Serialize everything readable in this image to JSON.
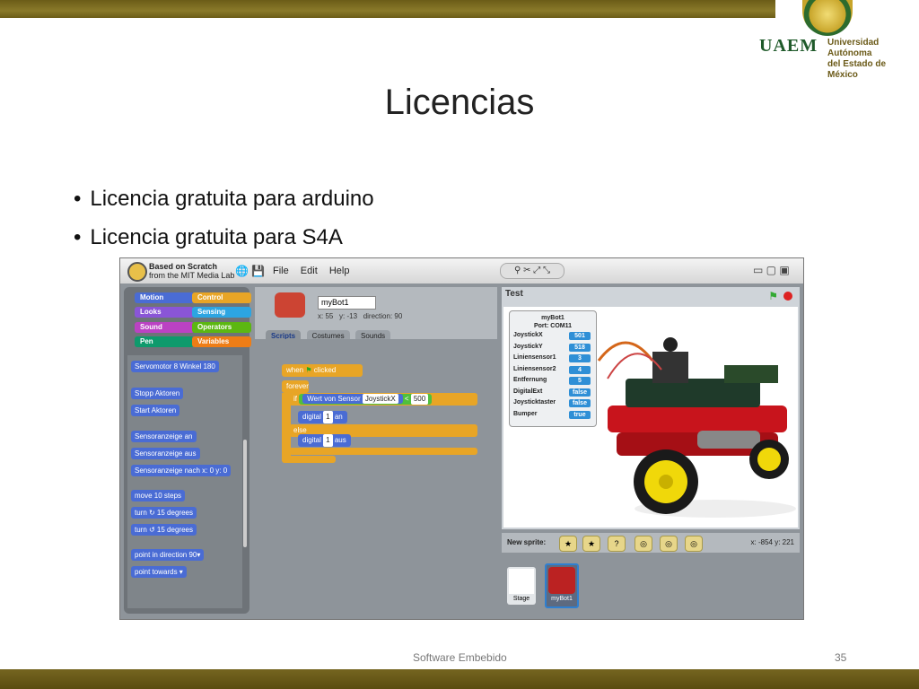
{
  "slide": {
    "title": "Licencias",
    "bullets": [
      "Licencia gratuita para arduino",
      "Licencia gratuita para S4A"
    ],
    "footer": "Software Embebido",
    "page_number": "35"
  },
  "logo": {
    "acronym": "UAEM",
    "university_line1": "Universidad Autónoma",
    "university_line2": "del Estado de México"
  },
  "scratch": {
    "brand_line1": "Based on Scratch",
    "brand_line2": "from the MIT Media Lab",
    "menu": [
      "File",
      "Edit",
      "Help"
    ],
    "categories": [
      {
        "label": "Motion",
        "color": "#4a6cd4"
      },
      {
        "label": "Control",
        "color": "#e8a526"
      },
      {
        "label": "Looks",
        "color": "#8a55d7"
      },
      {
        "label": "Sensing",
        "color": "#2ca5e2"
      },
      {
        "label": "Sound",
        "color": "#bb42c3"
      },
      {
        "label": "Operators",
        "color": "#5cb712"
      },
      {
        "label": "Pen",
        "color": "#0e9a6c"
      },
      {
        "label": "Variables",
        "color": "#ee7d16"
      }
    ],
    "palette_blocks": [
      "Servomotor 8 Winkel 180",
      "Stopp Aktoren",
      "Start Aktoren",
      "Sensoranzeige an",
      "Sensoranzeige aus",
      "Sensoranzeige nach x: 0 y: 0",
      "move 10 steps",
      "turn ↻ 15 degrees",
      "turn ↺ 15 degrees",
      "point in direction 90▾",
      "point towards ▾"
    ],
    "sprite": {
      "name": "myBot1",
      "x_label": "x: 55",
      "y_label": "y: -13",
      "direction_label": "direction: 90"
    },
    "tabs": [
      "Scripts",
      "Costumes",
      "Sounds"
    ],
    "script": {
      "hat": "when",
      "hat_tail": "clicked",
      "forever": "forever",
      "if": "if",
      "sensor_label": "Wert von Sensor",
      "sensor_name": "JoystickX",
      "compare_value": "500",
      "digital1": "digital",
      "digital1_pin": "1",
      "digital1_state": "an",
      "else": "else",
      "digital2": "digital",
      "digital2_pin": "1",
      "digital2_state": "aus"
    },
    "stage": {
      "title": "Test",
      "sensor_head1": "myBot1",
      "sensor_head2": "Port: COM11",
      "sensors": [
        {
          "name": "JoystickX",
          "value": "501"
        },
        {
          "name": "JoystickY",
          "value": "518"
        },
        {
          "name": "Liniensensor1",
          "value": "3"
        },
        {
          "name": "Liniensensor2",
          "value": "4"
        },
        {
          "name": "Entfernung",
          "value": "5"
        },
        {
          "name": "DigitalExt",
          "value": "false"
        },
        {
          "name": "Joysticktaster",
          "value": "false"
        },
        {
          "name": "Bumper",
          "value": "true"
        }
      ]
    },
    "new_sprite_label": "New sprite:",
    "coords": "x: -854   y: 221",
    "sprite_list": {
      "stage_label": "Stage",
      "bot_label": "myBot1"
    }
  }
}
